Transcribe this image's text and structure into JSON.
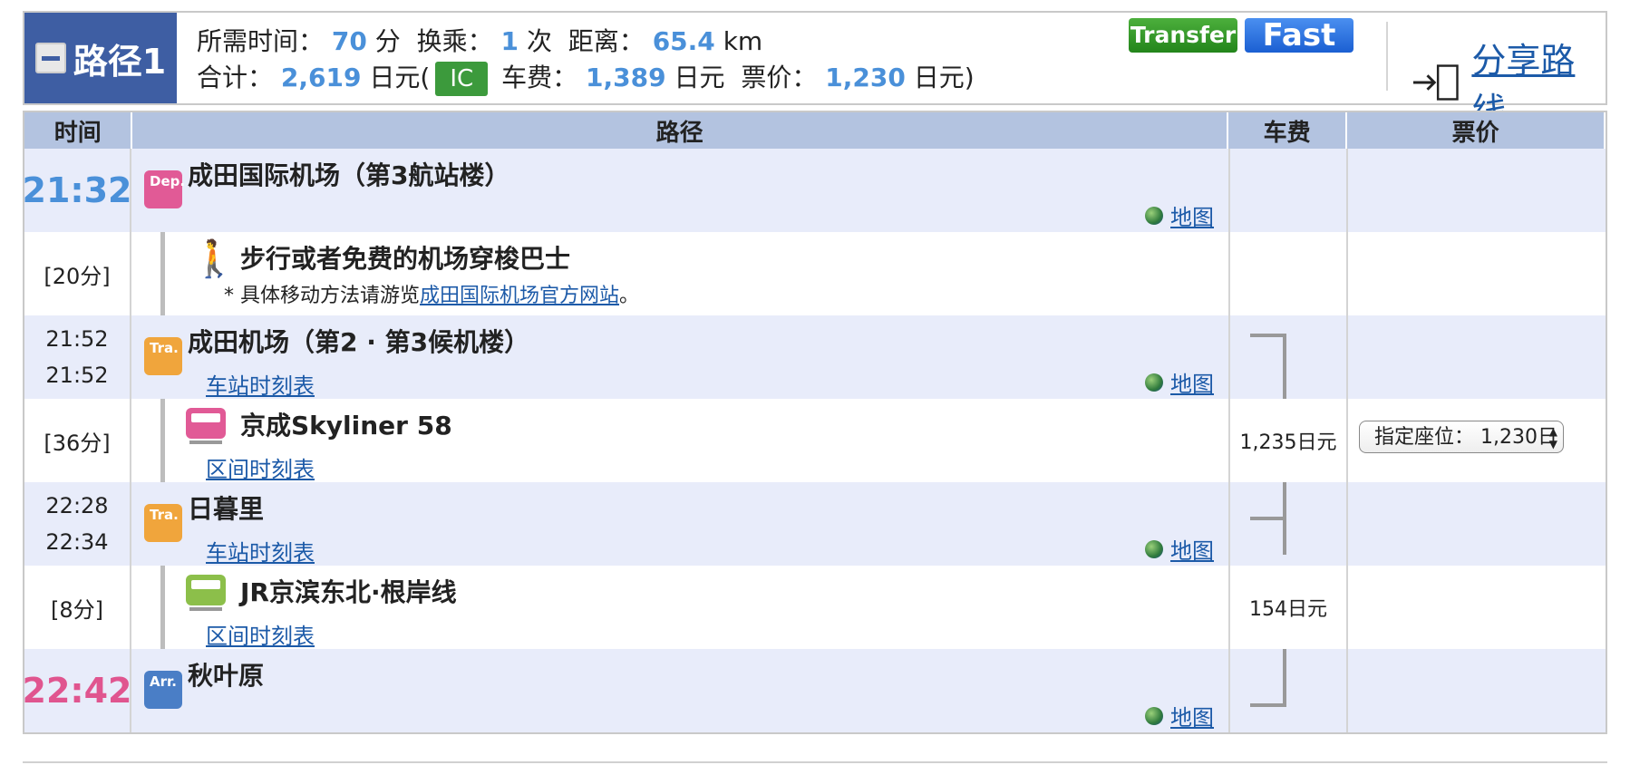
{
  "summary": {
    "route_label": "路径1",
    "time_label": "所需时间：",
    "time_value": "70",
    "time_unit": "分",
    "transfer_label": "换乘：",
    "transfer_value": "1",
    "transfer_unit": "次",
    "distance_label": "距离：",
    "distance_value": "65.4",
    "distance_unit": "km",
    "total_label": "合计：",
    "total_value": "2,619",
    "total_unit": "日元(",
    "ic_label": "IC",
    "fare_label": "车费：",
    "fare_value": "1,389",
    "fare_unit": "日元",
    "ticket_label": "票价：",
    "ticket_value": "1,230",
    "ticket_unit": "日元)",
    "tag_transfer": "Transfer",
    "tag_fast": "Fast",
    "share_label": "分享路线"
  },
  "table": {
    "headers": [
      "时间",
      "路径",
      "车费",
      "票价"
    ],
    "rows": [
      {
        "time": "21:32",
        "station": "成田国际机场（第3航站楼）",
        "icon": "Dep.",
        "map": "地图"
      },
      {
        "duration": "[20分]",
        "segment": "步行或者免费的机场穿梭巴士",
        "note_prefix": "* 具体移动方法请游览",
        "note_link": "成田国际机场官方网站",
        "note_suffix": "。"
      },
      {
        "time_arr": "21:52",
        "time_dep": "21:52",
        "station": "成田机场（第2 · 第3候机楼）",
        "icon": "Tra.",
        "link": "车站时刻表",
        "map": "地图"
      },
      {
        "duration": "[36分]",
        "segment": "京成Skyliner 58",
        "link": "区间时刻表",
        "fare": "1,235日元",
        "seat": "指定座位：  1,230日"
      },
      {
        "time_arr": "22:28",
        "time_dep": "22:34",
        "station": "日暮里",
        "icon": "Tra.",
        "link": "车站时刻表",
        "map": "地图"
      },
      {
        "duration": "[8分]",
        "segment": "JR京滨东北·根岸线",
        "link": "区间时刻表",
        "fare": "154日元"
      },
      {
        "time": "22:42",
        "station": "秋叶原",
        "icon": "Arr.",
        "map": "地图"
      }
    ]
  },
  "colors": {
    "accent": "#3e5ea3",
    "header_bg": "#b3c3e0",
    "stn_bg": "#e8ecfa",
    "value": "#4a90d9",
    "arrival": "#e0558f",
    "link": "#1c5aa8"
  }
}
